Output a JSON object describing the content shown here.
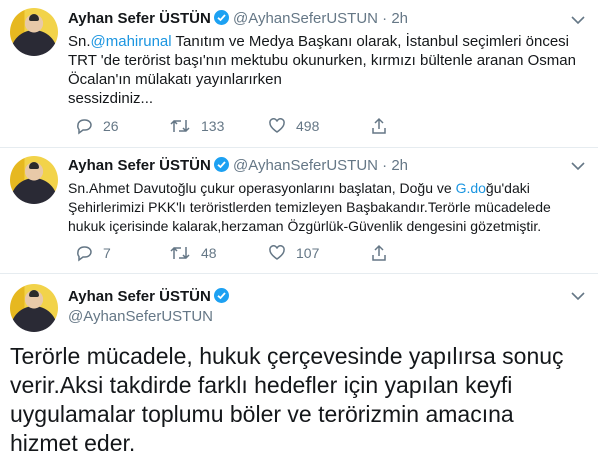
{
  "tweets": [
    {
      "name": "Ayhan Sefer ÜSTÜN",
      "handle": "@AyhanSeferUSTUN",
      "dot": "·",
      "time": "2h",
      "text_prefix": "Sn.",
      "mention": "@mahirunal",
      "text_line1_rest": " Tanıtım ve Medya Başkanı olarak, İstanbul seçimleri öncesi",
      "text_line2": "TRT 'de terörist başı'nın mektubu okunurken, kırmızı bültenle aranan Osman",
      "text_line3": "Öcalan'ın mülakatı yayınlarırken",
      "text_line4": "sessizdiniz...",
      "replies": "26",
      "retweets": "133",
      "likes": "498"
    },
    {
      "name": "Ayhan Sefer ÜSTÜN",
      "handle": "@AyhanSeferUSTUN",
      "dot": "·",
      "time": "2h",
      "text_line1_pre": "Sn.Ahmet Davutoğlu çukur operasyonlarını başlatan, Doğu ve ",
      "link": "G.do",
      "text_line1_post": "ğu'daki",
      "text_line2": "Şehirlerimizi PKK'lı teröristlerden temizleyen Başbakandır.Terörle mücadelede",
      "text_line3": "hukuk içerisinde kalarak,herzaman Özgürlük-Güvenlik dengesini gözetmiştir.",
      "replies": "7",
      "retweets": "48",
      "likes": "107"
    },
    {
      "name": "Ayhan Sefer ÜSTÜN",
      "handle": "@AyhanSeferUSTUN",
      "text_line1": "Terörle mücadele, hukuk çerçevesinde yapılırsa sonuç",
      "text_line2": "verir.Aksi takdirde farklı hedefler için yapılan keyfi",
      "text_line3": "uygulamalar toplumu böler ve terörizmin amacına",
      "text_line4": "hizmet eder."
    }
  ],
  "colors": {
    "accent": "#1da1f2",
    "link": "#1b95e0",
    "muted": "#657786"
  }
}
